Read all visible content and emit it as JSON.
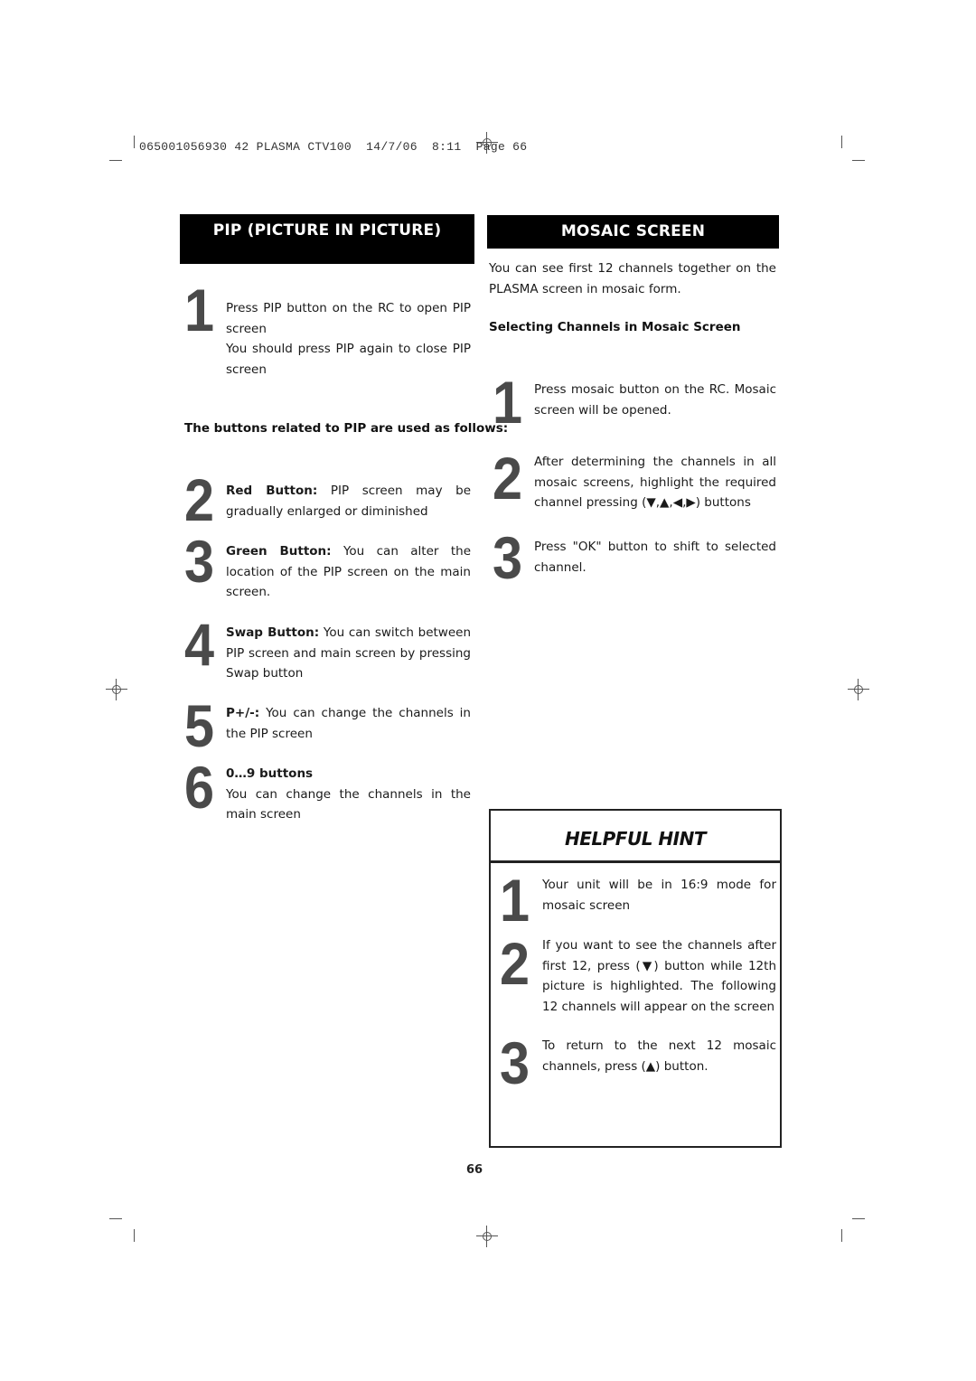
{
  "slug": {
    "text": "065001056930 42 PLASMA CTV100  14/7/06  8:11  Page 66"
  },
  "pip_section": {
    "title": "PIP (PICTURE IN PICTURE)",
    "step1": {
      "number": "1",
      "line1": "Press PIP button on the RC to open PIP screen",
      "line2": "You should press PIP again to close PIP screen"
    },
    "buttons_heading": "The buttons related to PIP are used as follows:",
    "steps": [
      {
        "number": "2",
        "label": "Red Button:",
        "text": " PIP screen may be gradually enlarged or diminished"
      },
      {
        "number": "3",
        "label": "Green Button:",
        "text": " You can alter the location of the PIP screen on the main screen."
      },
      {
        "number": "4",
        "label": "Swap Button:",
        "text": " You can switch between PIP screen and main screen by pressing Swap button"
      },
      {
        "number": "5",
        "label": "P+/-:",
        "text": " You can change the channels in the PIP screen"
      },
      {
        "number": "6",
        "label": "0…9 buttons",
        "text": "You can change the channels in the main screen"
      }
    ]
  },
  "mosaic_section": {
    "title": "MOSAIC SCREEN",
    "intro": "You can see first 12 channels  together on the PLASMA  screen in mosaic form.",
    "subheading": "Selecting Channels in Mosaic Screen",
    "steps": [
      {
        "number": "1",
        "text": "Press mosaic button on the RC. Mosaic screen will be opened."
      },
      {
        "number": "2",
        "text": "After determining the channels in all mosaic screens, highlight the required channel pressing  (▼,▲,◀,▶) buttons"
      },
      {
        "number": "3",
        "text": "Press \"OK\" button to shift to selected channel."
      }
    ]
  },
  "helpful_hint": {
    "title": "HELPFUL HINT",
    "steps": [
      {
        "number": "1",
        "text": "Your unit will be in 16:9 mode for mosaic screen"
      },
      {
        "number": "2",
        "text": "If you want to see the channels after first 12,  press  (▼) button while 12th picture is  highlighted.  The following 12 channels will appear on the screen"
      },
      {
        "number": "3",
        "text": "To return to the next 12 mosaic channels, press  (▲) button."
      }
    ]
  },
  "footer": {
    "page_number": "66"
  }
}
